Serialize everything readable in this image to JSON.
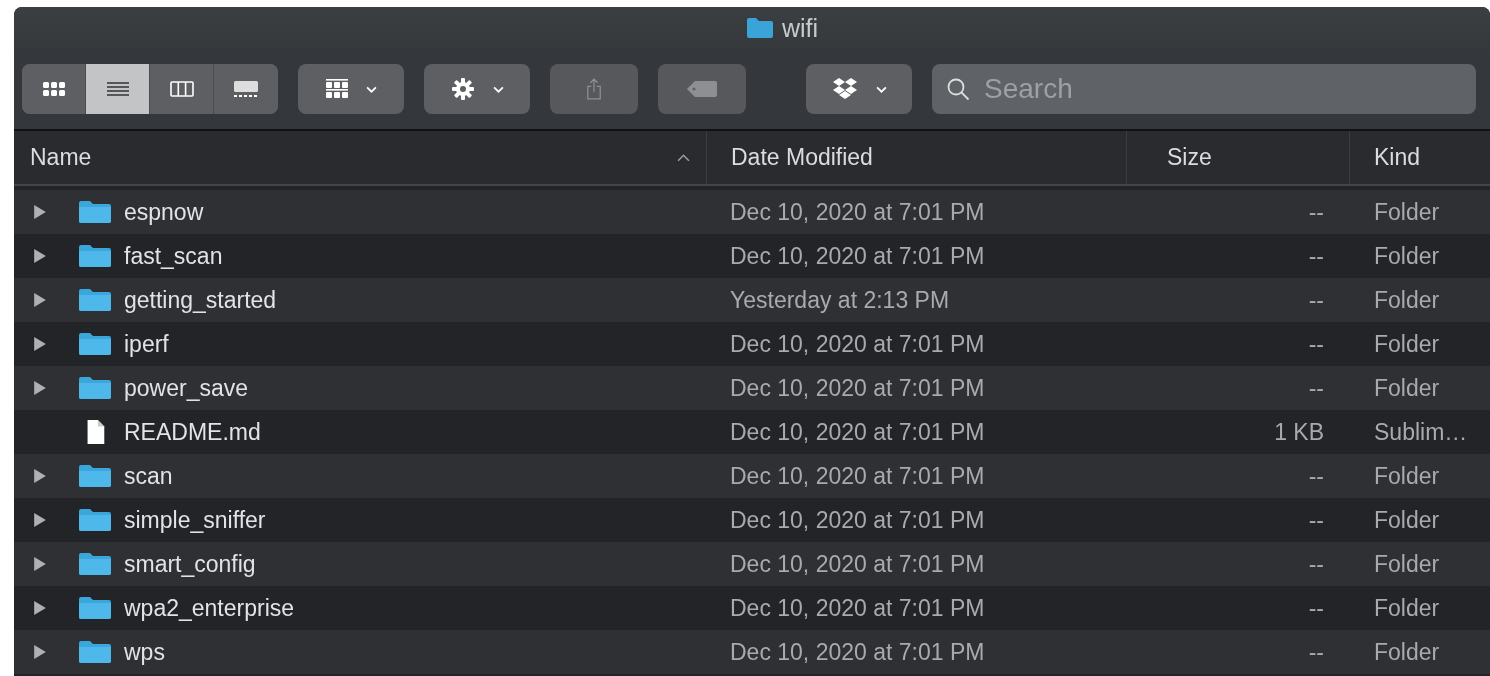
{
  "window": {
    "title": "wifi"
  },
  "toolbar": {
    "view_modes": [
      {
        "kind": "icons",
        "selected": false
      },
      {
        "kind": "list",
        "selected": true
      },
      {
        "kind": "columns",
        "selected": false
      },
      {
        "kind": "gallery",
        "selected": false
      }
    ],
    "buttons": [
      {
        "kind": "group"
      },
      {
        "kind": "action"
      },
      {
        "kind": "share",
        "disabled": true
      },
      {
        "kind": "tag",
        "disabled": true
      },
      {
        "kind": "dropbox"
      }
    ],
    "search": {
      "placeholder": "Search"
    }
  },
  "table": {
    "columns": [
      {
        "label": "Name",
        "sorted": true
      },
      {
        "label": "Date Modified",
        "sorted": false
      },
      {
        "label": "Size",
        "sorted": false
      },
      {
        "label": "Kind",
        "sorted": false
      }
    ],
    "rows": [
      {
        "kind": "folder",
        "name": "espnow",
        "date": "Dec 10, 2020 at 7:01 PM",
        "size": "--",
        "type": "Folder"
      },
      {
        "kind": "folder",
        "name": "fast_scan",
        "date": "Dec 10, 2020 at 7:01 PM",
        "size": "--",
        "type": "Folder"
      },
      {
        "kind": "folder",
        "name": "getting_started",
        "date": "Yesterday at 2:13 PM",
        "size": "--",
        "type": "Folder"
      },
      {
        "kind": "folder",
        "name": "iperf",
        "date": "Dec 10, 2020 at 7:01 PM",
        "size": "--",
        "type": "Folder"
      },
      {
        "kind": "folder",
        "name": "power_save",
        "date": "Dec 10, 2020 at 7:01 PM",
        "size": "--",
        "type": "Folder"
      },
      {
        "kind": "file",
        "name": "README.md",
        "date": "Dec 10, 2020 at 7:01 PM",
        "size": "1 KB",
        "type": "Sublim…"
      },
      {
        "kind": "folder",
        "name": "scan",
        "date": "Dec 10, 2020 at 7:01 PM",
        "size": "--",
        "type": "Folder"
      },
      {
        "kind": "folder",
        "name": "simple_sniffer",
        "date": "Dec 10, 2020 at 7:01 PM",
        "size": "--",
        "type": "Folder"
      },
      {
        "kind": "folder",
        "name": "smart_config",
        "date": "Dec 10, 2020 at 7:01 PM",
        "size": "--",
        "type": "Folder"
      },
      {
        "kind": "folder",
        "name": "wpa2_enterprise",
        "date": "Dec 10, 2020 at 7:01 PM",
        "size": "--",
        "type": "Folder"
      },
      {
        "kind": "folder",
        "name": "wps",
        "date": "Dec 10, 2020 at 7:01 PM",
        "size": "--",
        "type": "Folder"
      }
    ]
  }
}
